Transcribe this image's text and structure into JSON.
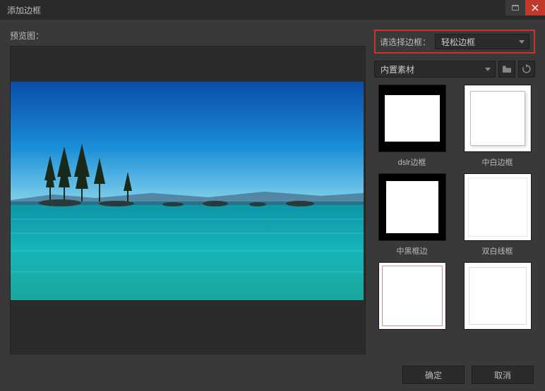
{
  "window": {
    "title": "添加边框"
  },
  "preview": {
    "label": "预览图："
  },
  "selector": {
    "label": "请选择边框：",
    "value": "轻松边框"
  },
  "source": {
    "value": "内置素材",
    "folder_icon": "folder-icon",
    "refresh_icon": "refresh-icon"
  },
  "frames": [
    {
      "label": "dslr边框",
      "style": "t-dslr"
    },
    {
      "label": "中白边框",
      "style": "t-white-mid"
    },
    {
      "label": "中黑框边",
      "style": "t-black-mid"
    },
    {
      "label": "双白线框",
      "style": "t-dbl-white"
    },
    {
      "label": "",
      "style": "t-red-line"
    },
    {
      "label": "",
      "style": "t-white-thin"
    }
  ],
  "buttons": {
    "ok": "确定",
    "cancel": "取消"
  }
}
